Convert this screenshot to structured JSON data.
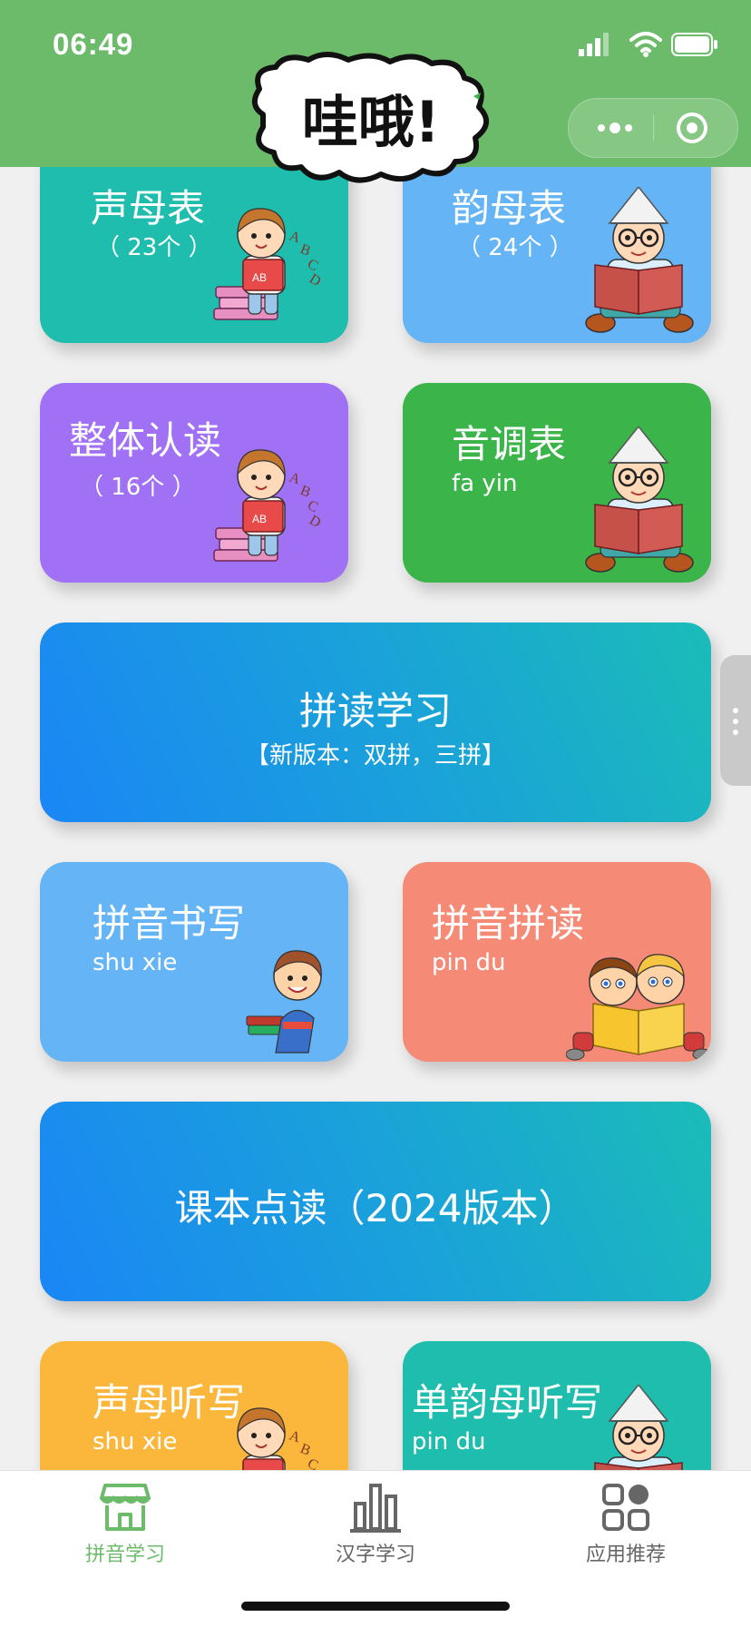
{
  "status_bar": {
    "time": "06:49"
  },
  "header": {
    "logo_text": "哇哦!"
  },
  "cards": {
    "shengmu": {
      "title": "声母表",
      "sub": "（ 23个 ）"
    },
    "yunmu": {
      "title": "韵母表",
      "sub": "（ 24个 ）"
    },
    "zhengti": {
      "title": "整体认读",
      "sub": "（ 16个 ）"
    },
    "yindiao": {
      "title": "音调表",
      "sub": "fa yin"
    },
    "pindu_study": {
      "title": "拼读学习",
      "sub": "【新版本：双拼，三拼】"
    },
    "pinyin_write": {
      "title": "拼音书写",
      "sub": "shu xie"
    },
    "pinyin_read": {
      "title": "拼音拼读",
      "sub": "pin du"
    },
    "textbook": {
      "title": "课本点读（2024版本）"
    },
    "shengmu_dictation": {
      "title": "声母听写",
      "sub": "shu xie"
    },
    "danyunmu_dictation": {
      "title": "单韵母听写",
      "sub": "pin du"
    }
  },
  "tabbar": {
    "items": [
      {
        "label": "拼音学习",
        "icon": "store-icon",
        "active": true
      },
      {
        "label": "汉字学习",
        "icon": "bar-chart-icon",
        "active": false
      },
      {
        "label": "应用推荐",
        "icon": "apps-icon",
        "active": false
      }
    ]
  },
  "colors": {
    "header_green": "#6cbb6a",
    "teal": "#1fbdae",
    "blue": "#64b4f6",
    "purple": "#a070f5",
    "green": "#3bb54a",
    "salmon": "#f58a76",
    "orange": "#fbb73c"
  }
}
